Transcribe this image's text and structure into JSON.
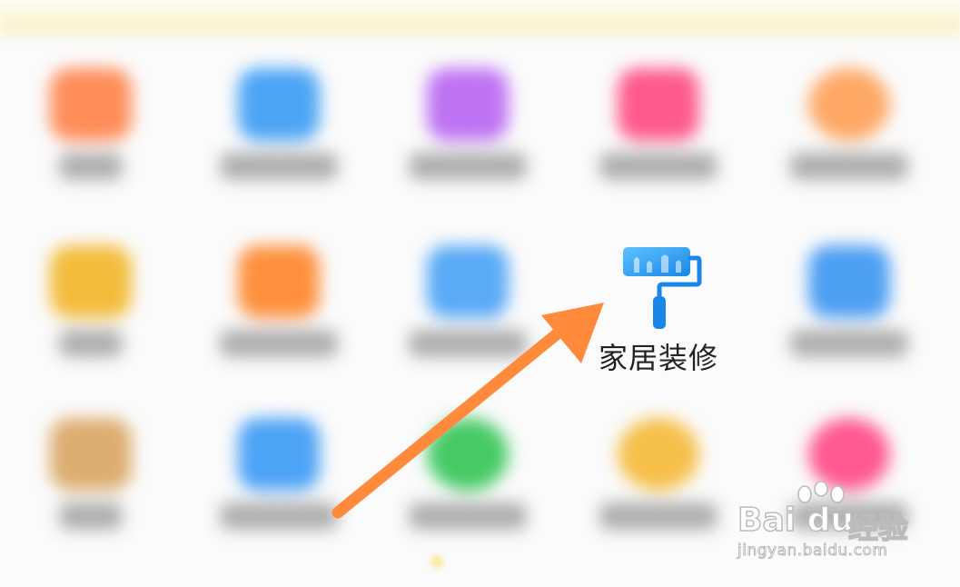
{
  "focused_app": {
    "label": "家居装修",
    "icon": "paint-roller-icon",
    "accent": "#1E9BF0"
  },
  "blurred_apps": [
    {
      "id": "r1c1",
      "icon": "app-icon",
      "color": "#FF7A3D"
    },
    {
      "id": "r1c2",
      "icon": "app-icon",
      "color": "#2E96F5"
    },
    {
      "id": "r1c3",
      "icon": "app-icon",
      "color": "#B45CF2"
    },
    {
      "id": "r1c4",
      "icon": "app-icon",
      "color": "#FF3F7A"
    },
    {
      "id": "r1c5",
      "icon": "app-icon",
      "color": "#FF9A4D"
    },
    {
      "id": "r2c1",
      "icon": "app-icon",
      "color": "#F2B21A"
    },
    {
      "id": "r2c2",
      "icon": "app-icon",
      "color": "#FF7E1C"
    },
    {
      "id": "r2c3",
      "icon": "app-icon",
      "color": "#3E9CF6"
    },
    {
      "id": "r2c5",
      "icon": "app-icon",
      "color": "#2F8FF2"
    },
    {
      "id": "r3c1",
      "icon": "app-icon",
      "color": "#D7A058"
    },
    {
      "id": "r3c2",
      "icon": "app-icon",
      "color": "#2F94F6"
    },
    {
      "id": "r3c3",
      "icon": "app-icon",
      "color": "#27C24C"
    },
    {
      "id": "r3c4",
      "icon": "app-icon",
      "color": "#F5B52A"
    },
    {
      "id": "r3c5",
      "icon": "app-icon",
      "color": "#FF3D7F"
    }
  ],
  "annotation": {
    "icon": "arrow-icon",
    "color": "#FF8A3C"
  },
  "watermark": {
    "brand": "Bai du",
    "brand_cn": "经验",
    "url": "jingyan.baidu.com"
  }
}
